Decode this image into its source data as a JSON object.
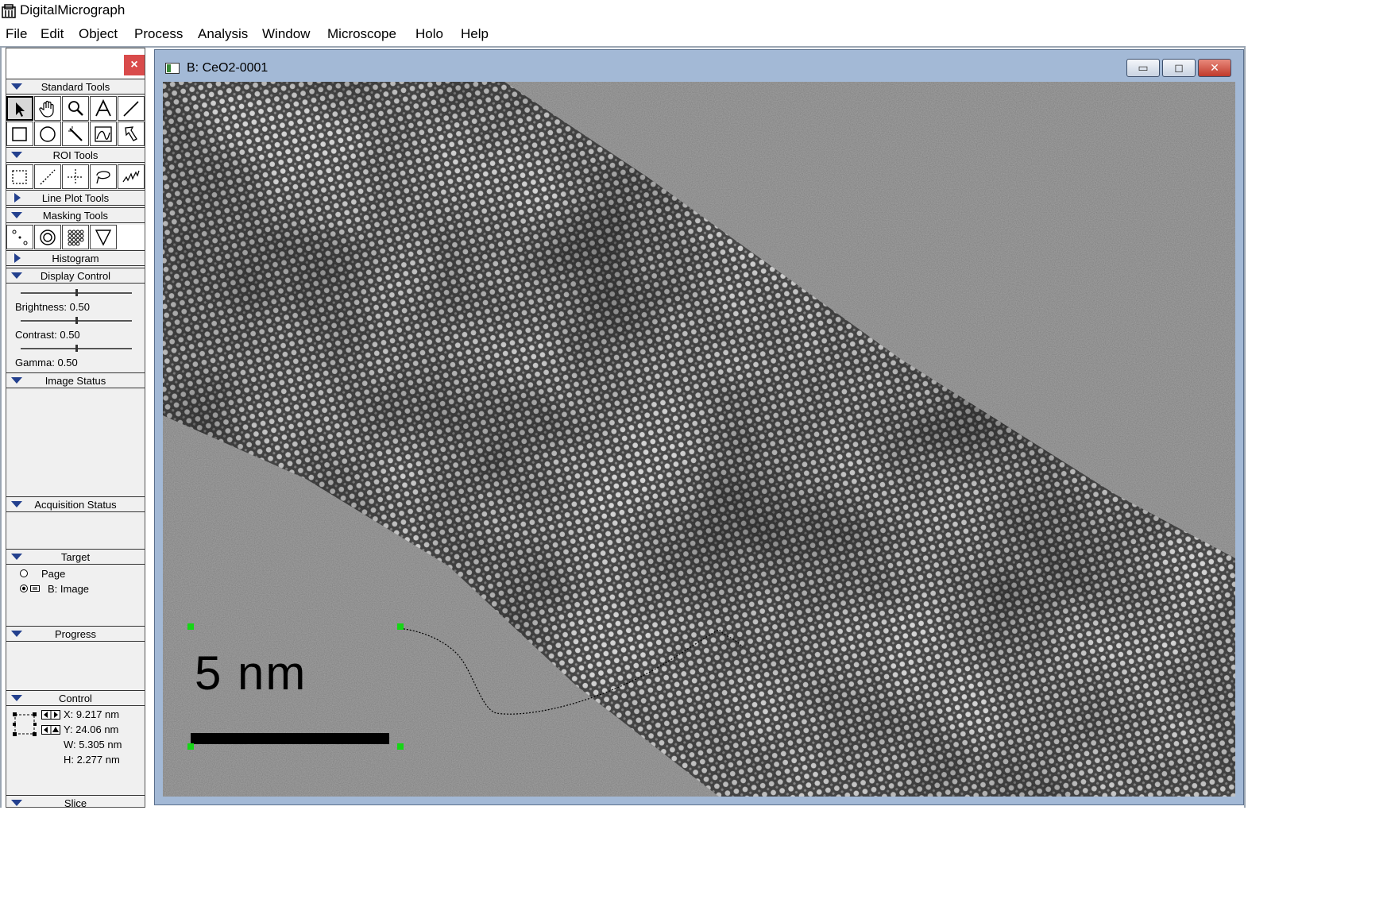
{
  "app": {
    "title": "DigitalMicrograph"
  },
  "menu": [
    "File",
    "Edit",
    "Object",
    "Process",
    "Analysis",
    "Window",
    "Microscope",
    "Holo",
    "Help"
  ],
  "palette": {
    "close_glyph": "×",
    "sections": {
      "standard_tools": "Standard Tools",
      "roi_tools": "ROI Tools",
      "line_plot_tools": "Line Plot Tools",
      "masking_tools": "Masking Tools",
      "histogram": "Histogram",
      "display_control": "Display Control",
      "image_status": "Image Status",
      "acquisition_status": "Acquisition Status",
      "target": "Target",
      "progress": "Progress",
      "control": "Control",
      "slice": "Slice"
    },
    "display_control": {
      "brightness": "Brightness: 0.50",
      "contrast": "Contrast: 0.50",
      "gamma": "Gamma: 0.50",
      "brightness_value": 0.5,
      "contrast_value": 0.5,
      "gamma_value": 0.5
    },
    "target": {
      "page": "Page",
      "image": "B: Image",
      "selected": "image"
    },
    "control": {
      "x": "X: 9.217 nm",
      "y": "Y: 24.06 nm",
      "w": "W: 5.305 nm",
      "h": "H: 2.277 nm"
    },
    "standard_tool_icons": [
      "arrow-icon",
      "hand-icon",
      "magnifier-icon",
      "text-icon",
      "line-icon",
      "rectangle-icon",
      "oval-icon",
      "wand-icon",
      "profile-icon",
      "pointer-hand-icon"
    ],
    "roi_tool_icons": [
      "rect-roi-icon",
      "line-roi-icon",
      "point-roi-icon",
      "lasso-roi-icon",
      "curve-roi-icon"
    ],
    "masking_tool_icons": [
      "spot-mask-icon",
      "ring-mask-icon",
      "array-mask-icon",
      "wedge-mask-icon"
    ]
  },
  "image_window": {
    "title": "B: CeO2-0001",
    "scale_bar_label": "5   nm",
    "minimize_glyph": "▭",
    "maximize_glyph": "◻",
    "close_glyph": "✕"
  },
  "colors": {
    "accent_triangle": "#23408e",
    "window_frame": "#a3b9d6",
    "roi_handle": "#15d615"
  }
}
